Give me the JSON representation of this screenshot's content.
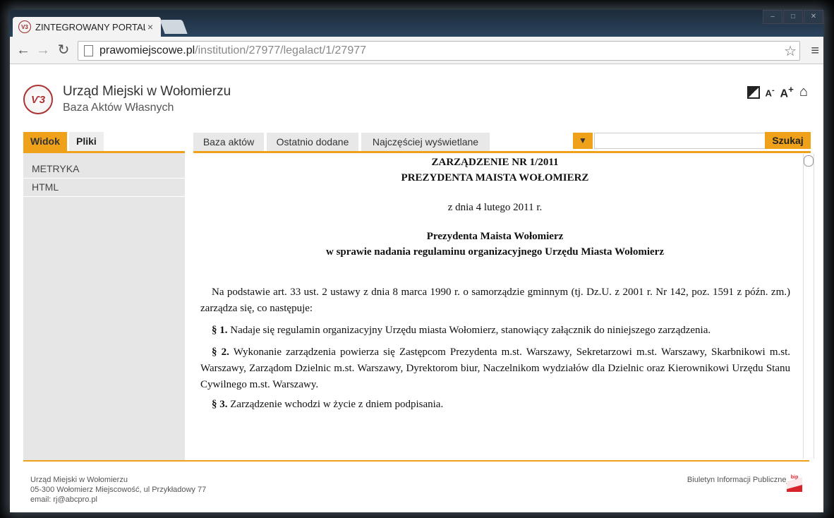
{
  "browser": {
    "tab_title": "ZINTEGROWANY PORTAL",
    "tab_close": "×",
    "url_host": "prawomiejscowe.pl",
    "url_path": "/institution/27977/legalact/1/27977"
  },
  "header": {
    "org_name": "Urząd Miejski w Wołomierzu",
    "org_sub": "Baza Aktów Własnych",
    "logo_text": "Ѵ3",
    "font_small": "A",
    "font_small_sup": "-",
    "font_large": "A",
    "font_large_sup": "+",
    "home": "⌂"
  },
  "left_tabs": [
    "Widok",
    "Pliki"
  ],
  "left_items": [
    "METRYKA",
    "HTML"
  ],
  "main_tabs": [
    "Baza aktów",
    "Ostatnio dodane",
    "Najczęściej wyświetlane"
  ],
  "search": {
    "placeholder": "",
    "button": "Szukaj"
  },
  "document": {
    "title1": "ZARZĄDZENIE NR 1/2011",
    "title2": "PREZYDENTA MAISTA WOŁOMIERZ",
    "date": "z dnia 4 lutego 2011 r.",
    "subject1": "Prezydenta Maista Wołomierz",
    "subject2": "w sprawie nadania regulaminu organizacyjnego Urzędu Miasta Wołomierz",
    "preamble": "Na podstawie art. 33 ust. 2  ustawy z dnia 8  marca 1990 r. o samorządzie gminnym (tj. Dz.U. z 2001 r. Nr 142, poz. 1591 z późn. zm.) zarządza się, co następuje:",
    "p1_sym": "§ 1.",
    "p1": " Nadaje się regulamin organizacyjny Urzędu miasta Wołomierz, stanowiący załącznik do niniejszego zarządzenia.",
    "p2_sym": "§ 2.",
    "p2": " Wykonanie zarządzenia powierza się Zastępcom Prezydenta m.st. Warszawy, Sekretarzowi m.st. Warszawy, Skarbnikowi m.st. Warszawy, Zarządom Dzielnic m.st. Warszawy, Dyrektorom biur, Naczelnikom wydziałów dla Dzielnic oraz Kierownikowi Urzędu Stanu Cywilnego m.st. Warszawy.",
    "p3_sym": "§ 3.",
    "p3": " Zarządzenie wchodzi w życie z dniem podpisania."
  },
  "footer": {
    "line1": "Urząd Miejski w Wołomierzu",
    "line2": "05-300 Wołomierz Miejscowość, ul Przykładowy 77",
    "line3": "email: rj@abcpro.pl",
    "bip": "Biuletyn Informacji Publicznej",
    "bip_logo": "bip"
  },
  "colors": {
    "accent": "#f0a11a",
    "panel": "#e6e6e6"
  }
}
